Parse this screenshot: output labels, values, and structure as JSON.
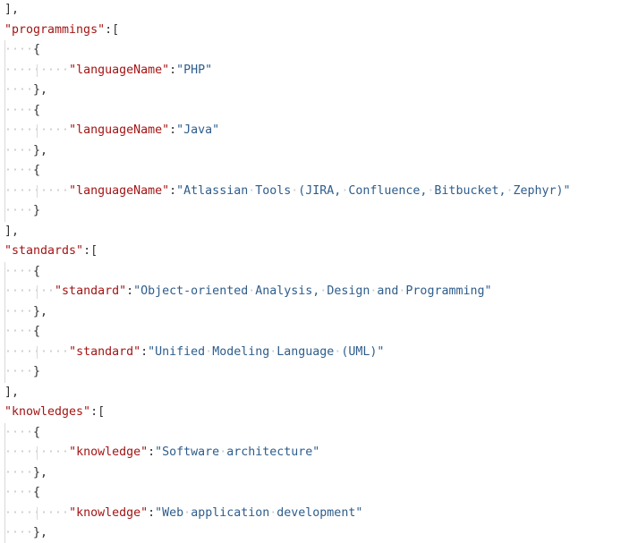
{
  "editor": {
    "lines": [
      {
        "indent": 0,
        "text": "],"
      },
      {
        "indent": 0,
        "key": "\"programmings\"",
        "punc": ":["
      },
      {
        "indent": 1,
        "text": "{"
      },
      {
        "indent": 2,
        "key": "\"languageName\"",
        "punc": ":",
        "value": "\"PHP\""
      },
      {
        "indent": 1,
        "text": "},"
      },
      {
        "indent": 1,
        "text": "{"
      },
      {
        "indent": 2,
        "key": "\"languageName\"",
        "punc": ":",
        "value": "\"Java\""
      },
      {
        "indent": 1,
        "text": "},"
      },
      {
        "indent": 1,
        "text": "{"
      },
      {
        "indent": 2,
        "key": "\"languageName\"",
        "punc": ":",
        "value": "\"Atlassian Tools (JIRA, Confluence, Bitbucket, Zephyr)\""
      },
      {
        "indent": 1,
        "text": "}"
      },
      {
        "indent": 0,
        "text": "],"
      },
      {
        "indent": 0,
        "key": "\"standards\"",
        "punc": ":["
      },
      {
        "indent": 1,
        "text": "{"
      },
      {
        "indent": 2,
        "key": "\"standard\"",
        "punc": ":",
        "value": "\"Object-oriented Analysis, Design and Programming\"",
        "short_indent": true
      },
      {
        "indent": 1,
        "text": "},"
      },
      {
        "indent": 1,
        "text": "{"
      },
      {
        "indent": 2,
        "key": "\"standard\"",
        "punc": ":",
        "value": "\"Unified Modeling Language (UML)\""
      },
      {
        "indent": 1,
        "text": "}"
      },
      {
        "indent": 0,
        "text": "],"
      },
      {
        "indent": 0,
        "key": "\"knowledges\"",
        "punc": ":["
      },
      {
        "indent": 1,
        "text": "{"
      },
      {
        "indent": 2,
        "key": "\"knowledge\"",
        "punc": ":",
        "value": "\"Software architecture\""
      },
      {
        "indent": 1,
        "text": "},"
      },
      {
        "indent": 1,
        "text": "{"
      },
      {
        "indent": 2,
        "key": "\"knowledge\"",
        "punc": ":",
        "value": "\"Web application development\""
      },
      {
        "indent": 1,
        "text": "},"
      }
    ]
  },
  "colors": {
    "key": "#a31515",
    "string": "#2e5d8c",
    "punctuation": "#333333",
    "whitespace_marker": "#c8c8c8",
    "indent_guide": "#d8d8d8",
    "background": "#ffffff"
  }
}
